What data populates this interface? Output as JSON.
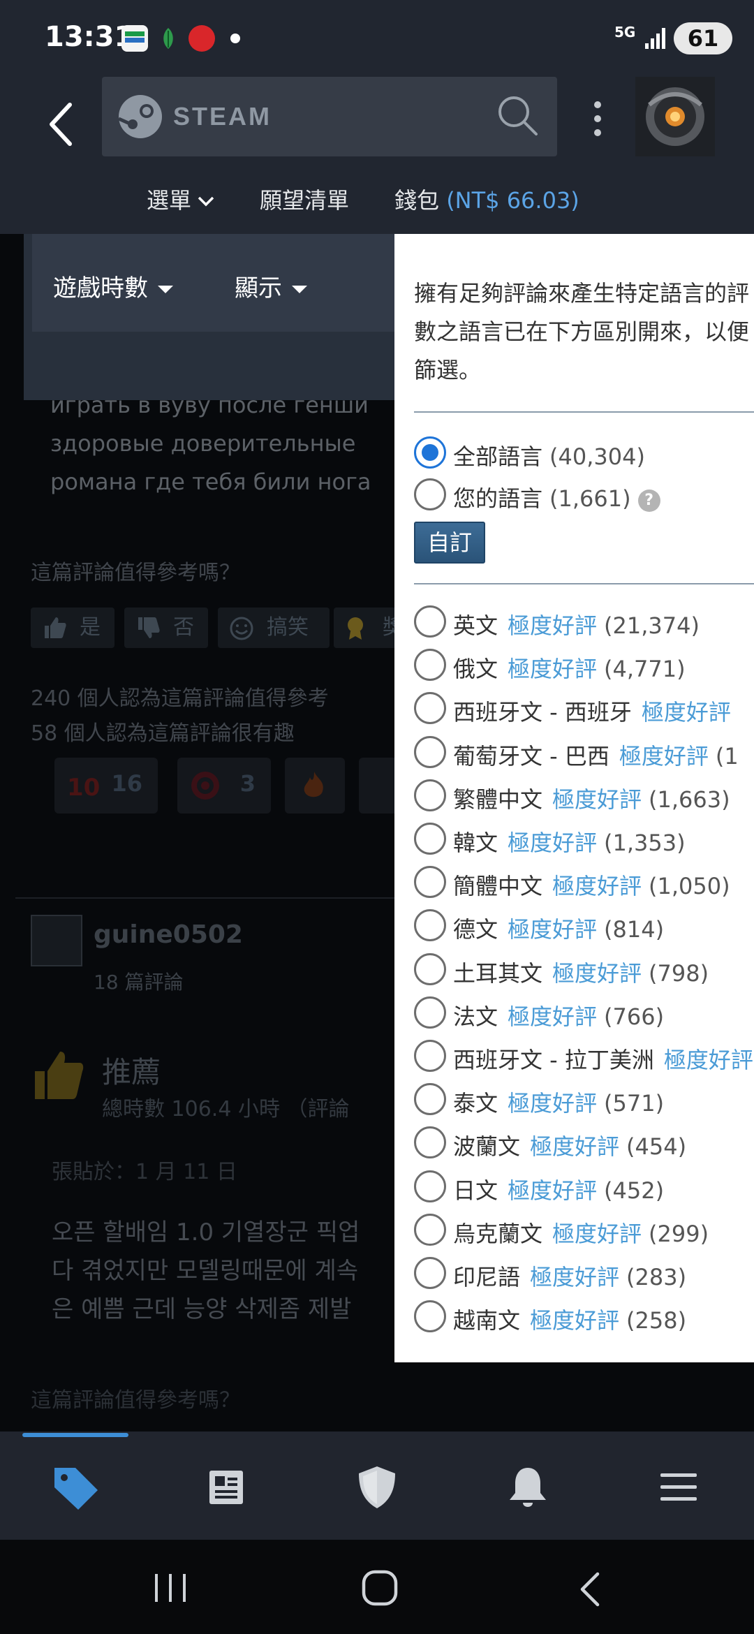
{
  "status_bar": {
    "time": "13:31",
    "network": "5G",
    "battery": "61"
  },
  "header": {
    "search_brand": "STEAM",
    "nav": {
      "menu": "選單",
      "wishlist": "願望清單",
      "wallet_label": "錢包",
      "wallet_amount": "(NT$ 66.03)"
    }
  },
  "filters": {
    "playtime": "遊戲時數",
    "display": "顯示"
  },
  "background_review": {
    "russian_lines": [
      "играть в вуву после генши",
      "здоровые доверительные",
      "романа где тебя били нога"
    ],
    "helpful_question": "這篇評論值得參考嗎？",
    "vote_buttons": {
      "yes": "是",
      "no": "否",
      "funny": "搞笑",
      "award": "獎"
    },
    "helpful_count": "240 個人認為這篇評論值得參考",
    "funny_count": "58 個人認為這篇評論很有趣",
    "awards": [
      {
        "count": "16"
      },
      {
        "count": "3"
      }
    ]
  },
  "next_review": {
    "author": "guine0502",
    "review_count": "18 篇評論",
    "verdict": "推薦",
    "hours": "總時數 106.4 小時 （評論",
    "posted": "張貼於：1 月 11 日",
    "korean_lines": [
      "오픈 할배임 1.0 기열장군 픽업",
      "다 겪었지만 모델링때문에 계속",
      "은 예쁨 근데 능양 삭제좀 제발"
    ],
    "helpful_question": "這篇評論值得參考嗎？"
  },
  "language_popup": {
    "description_lines": [
      "擁有足夠評論來產生特定語言的評",
      "數之語言已在下方區別開來，以便",
      "篩選。"
    ],
    "all_languages": {
      "label": "全部語言",
      "count": "(40,304)",
      "selected": true
    },
    "your_languages": {
      "label": "您的語言",
      "count": "(1,661)",
      "help": "?"
    },
    "custom_button": "自訂",
    "languages": [
      {
        "name": "英文",
        "rating": "極度好評",
        "count": "(21,374)"
      },
      {
        "name": "俄文",
        "rating": "極度好評",
        "count": "(4,771)"
      },
      {
        "name": "西班牙文 - 西班牙",
        "rating": "極度好評",
        "count": ""
      },
      {
        "name": "葡萄牙文 - 巴西",
        "rating": "極度好評",
        "count": "(1"
      },
      {
        "name": "繁體中文",
        "rating": "極度好評",
        "count": "(1,663)"
      },
      {
        "name": "韓文",
        "rating": "極度好評",
        "count": "(1,353)"
      },
      {
        "name": "簡體中文",
        "rating": "極度好評",
        "count": "(1,050)"
      },
      {
        "name": "德文",
        "rating": "極度好評",
        "count": "(814)"
      },
      {
        "name": "土耳其文",
        "rating": "極度好評",
        "count": "(798)"
      },
      {
        "name": "法文",
        "rating": "極度好評",
        "count": "(766)"
      },
      {
        "name": "西班牙文 - 拉丁美洲",
        "rating": "極度好評",
        "count": ""
      },
      {
        "name": "泰文",
        "rating": "極度好評",
        "count": "(571)"
      },
      {
        "name": "波蘭文",
        "rating": "極度好評",
        "count": "(454)"
      },
      {
        "name": "日文",
        "rating": "極度好評",
        "count": "(452)"
      },
      {
        "name": "烏克蘭文",
        "rating": "極度好評",
        "count": "(299)"
      },
      {
        "name": "印尼語",
        "rating": "極度好評",
        "count": "(283)"
      },
      {
        "name": "越南文",
        "rating": "極度好評",
        "count": "(258)"
      }
    ]
  },
  "tab_bar": {
    "icons": [
      "store-tag-icon",
      "news-icon",
      "guard-shield-icon",
      "notification-bell-icon",
      "menu-icon"
    ],
    "active": "store-tag-icon"
  },
  "colors": {
    "accent_blue": "#5ba4e6",
    "radio_blue": "#1e74d8",
    "rating_blue": "#4a9bd6",
    "header_bg": "#212630"
  }
}
